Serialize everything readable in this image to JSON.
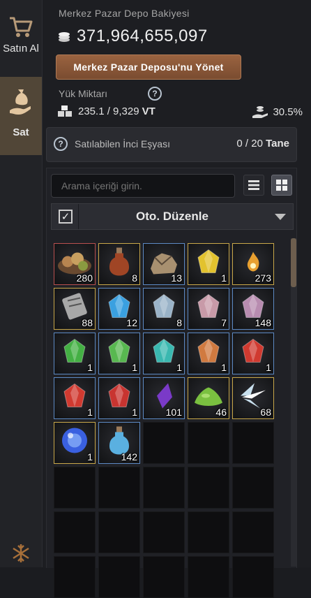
{
  "sidebar": {
    "buy_label": "Satın Al",
    "sell_label": "Sat"
  },
  "storage": {
    "title": "Merkez Pazar Depo Bakiyesi",
    "balance": "371,964,655,097",
    "manage_button": "Merkez Pazar Deposu'nu Yönet",
    "weight_label": "Yük Miktarı",
    "weight_value": "235.1 / 9,329",
    "weight_unit": "VT",
    "percent": "30.5%"
  },
  "pearl_items": {
    "label": "Satılabilen İnci Eşyası",
    "value": "0 / 20",
    "unit": "Tane"
  },
  "inventory": {
    "search_placeholder": "Arama içeriği girin.",
    "sort_label": "Oto. Düzenle",
    "auto_sort_checked": true,
    "total_slots": 40,
    "items": [
      {
        "icon": "meal-platter-icon",
        "qty": "280",
        "border": "#b9504f",
        "color": "#b88550"
      },
      {
        "icon": "elixir-bottle-icon",
        "qty": "8",
        "border": "#c9a84a",
        "color": "#a04525"
      },
      {
        "icon": "ore-rock-icon",
        "qty": "13",
        "border": "#5d8ac4",
        "color": "#a89070"
      },
      {
        "icon": "gold-crystal-icon",
        "qty": "1",
        "border": "#c9a84a",
        "color": "#e2c22e"
      },
      {
        "icon": "flame-spark-icon",
        "qty": "273",
        "border": "#c9a84a",
        "color": "#e8a030"
      },
      {
        "icon": "scroll-stone-icon",
        "qty": "88",
        "border": "#c9a84a",
        "color": "#a8a8a8"
      },
      {
        "icon": "blue-crystal-icon",
        "qty": "12",
        "border": "#5d8ac4",
        "color": "#3aa0e0"
      },
      {
        "icon": "violet-crystal-icon",
        "qty": "8",
        "border": "#5d8ac4",
        "color": "#9ab3c8"
      },
      {
        "icon": "violet-crystal-icon",
        "qty": "7",
        "border": "#5d8ac4",
        "color": "#c89aa8"
      },
      {
        "icon": "violet-crystal-icon",
        "qty": "148",
        "border": "#5d8ac4",
        "color": "#b88cb0"
      },
      {
        "icon": "green-crystal-icon",
        "qty": "1",
        "border": "#5d8ac4",
        "color": "#44b044"
      },
      {
        "icon": "green-crystal-icon",
        "qty": "1",
        "border": "#5d8ac4",
        "color": "#58b850"
      },
      {
        "icon": "cyan-crystal-icon",
        "qty": "1",
        "border": "#5d8ac4",
        "color": "#3ab8b0"
      },
      {
        "icon": "orange-crystal-icon",
        "qty": "1",
        "border": "#5d8ac4",
        "color": "#d07a40"
      },
      {
        "icon": "red-crystal-icon",
        "qty": "1",
        "border": "#5d8ac4",
        "color": "#d03a30"
      },
      {
        "icon": "red-crystal-icon",
        "qty": "1",
        "border": "#5d8ac4",
        "color": "#d03a30"
      },
      {
        "icon": "red-crystal-icon",
        "qty": "1",
        "border": "#5d8ac4",
        "color": "#c83430"
      },
      {
        "icon": "purple-shard-icon",
        "qty": "101",
        "border": "#5d8ac4",
        "color": "#7a3ac8"
      },
      {
        "icon": "green-slime-icon",
        "qty": "46",
        "border": "#c9a84a",
        "color": "#7ac040"
      },
      {
        "icon": "ice-shards-icon",
        "qty": "68",
        "border": "#c9a84a",
        "color": "#c8e0ee"
      },
      {
        "icon": "blue-orb-icon",
        "qty": "1",
        "border": "#c9a84a",
        "color": "#3a60e0"
      },
      {
        "icon": "potion-bottle-icon",
        "qty": "142",
        "border": "#5d8ac4",
        "color": "#5ab0e0"
      }
    ]
  }
}
